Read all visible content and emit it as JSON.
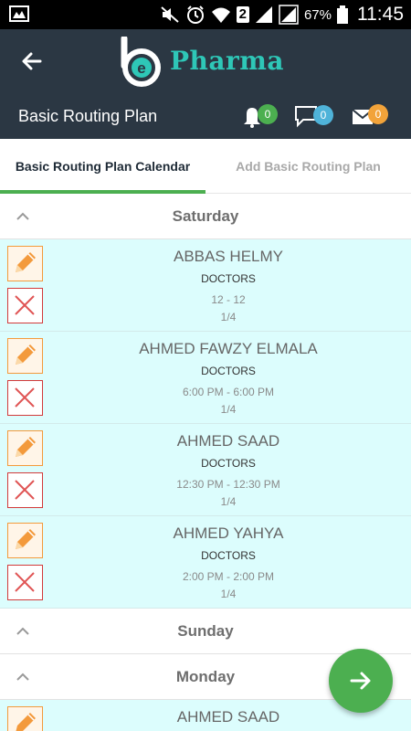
{
  "status_bar": {
    "battery": "67%",
    "time": "11:45",
    "sim": "2"
  },
  "app_bar": {
    "logo_text": "Pharma",
    "back_icon": "arrow-left-icon"
  },
  "sub_header": {
    "title": "Basic Routing Plan",
    "notifications": {
      "icon": "bell-icon",
      "count": "0",
      "color": "#4caf50"
    },
    "messages": {
      "icon": "chat-icon",
      "count": "0",
      "color": "#4fb3d9"
    },
    "mail": {
      "icon": "mail-icon",
      "count": "0",
      "color": "#f2a33a"
    }
  },
  "tabs": [
    {
      "label": "Basic Routing Plan Calendar",
      "active": true
    },
    {
      "label": "Add Basic Routing Plan",
      "active": false
    }
  ],
  "days": [
    {
      "label": "Saturday",
      "entries": [
        {
          "name": "ABBAS HELMY",
          "type": "DOCTORS",
          "time": "12 - 12",
          "count": "1/4"
        },
        {
          "name": "AHMED FAWZY ELMALA",
          "type": "DOCTORS",
          "time": "6:00 PM - 6:00 PM",
          "count": "1/4"
        },
        {
          "name": "AHMED SAAD",
          "type": "DOCTORS",
          "time": "12:30 PM - 12:30 PM",
          "count": "1/4"
        },
        {
          "name": "AHMED YAHYA",
          "type": "DOCTORS",
          "time": "2:00 PM - 2:00 PM",
          "count": "1/4"
        }
      ]
    },
    {
      "label": "Sunday",
      "entries": []
    },
    {
      "label": "Monday",
      "entries": [
        {
          "name": "AHMED SAAD"
        }
      ]
    }
  ],
  "colors": {
    "header": "#2b3743",
    "accent": "#4caf50",
    "card": "#dcfdfd",
    "edit": "#f39a3c",
    "delete": "#d23a3a"
  },
  "fab": {
    "icon": "arrow-right-icon"
  }
}
